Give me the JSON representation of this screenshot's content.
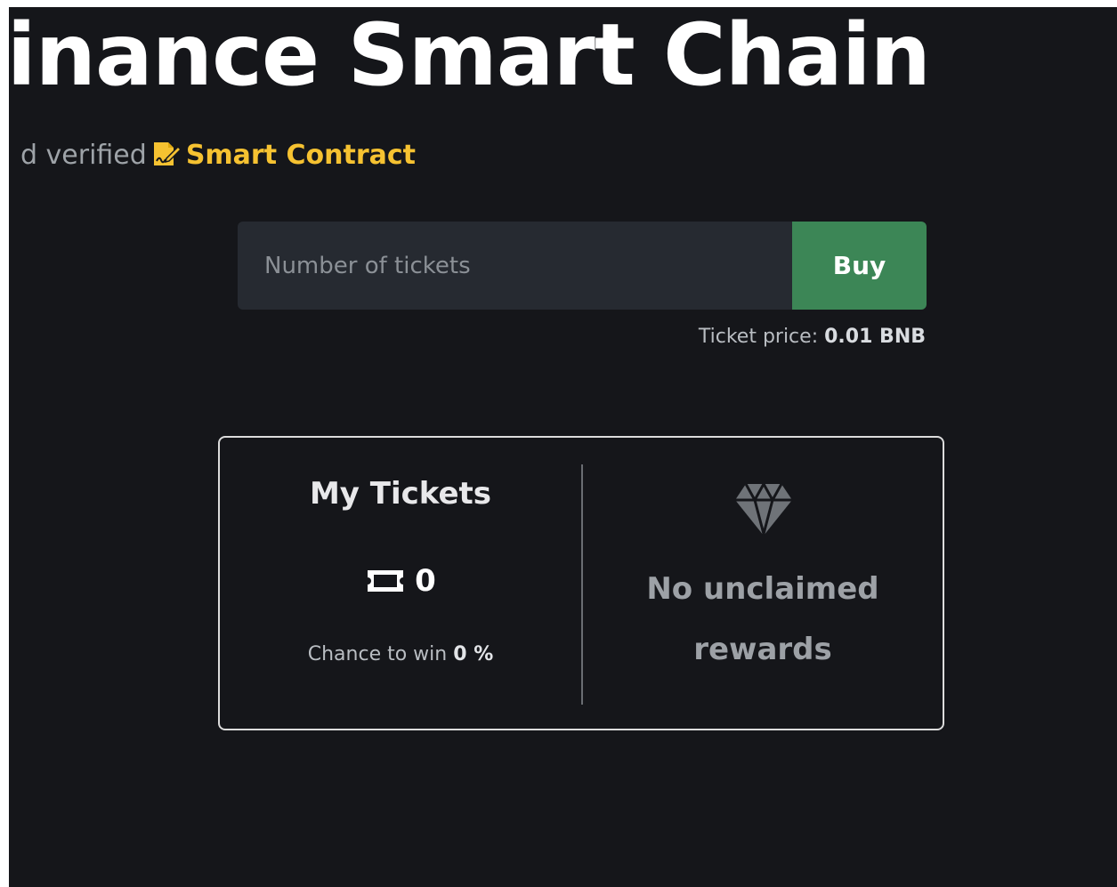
{
  "hero": {
    "title": "Binance Smart Chain"
  },
  "subline": {
    "lead_text": "d verified",
    "contract_icon": "contract-signature-icon",
    "contract_link": "Smart Contract",
    "contract_color": "#f6c231"
  },
  "buy": {
    "input_placeholder": "Number of tickets",
    "input_value": "",
    "button_label": "Buy",
    "button_color": "#3c8656",
    "price_label": "Ticket price:",
    "price_value": "0.01 BNB"
  },
  "my_tickets": {
    "title": "My Tickets",
    "icon": "ticket-icon",
    "count": "0",
    "chance_label": "Chance to win",
    "chance_value": "0 %"
  },
  "rewards": {
    "icon": "diamond-icon",
    "message": "No unclaimed rewards"
  },
  "colors": {
    "background": "#15161a",
    "input_background": "#262a31"
  }
}
